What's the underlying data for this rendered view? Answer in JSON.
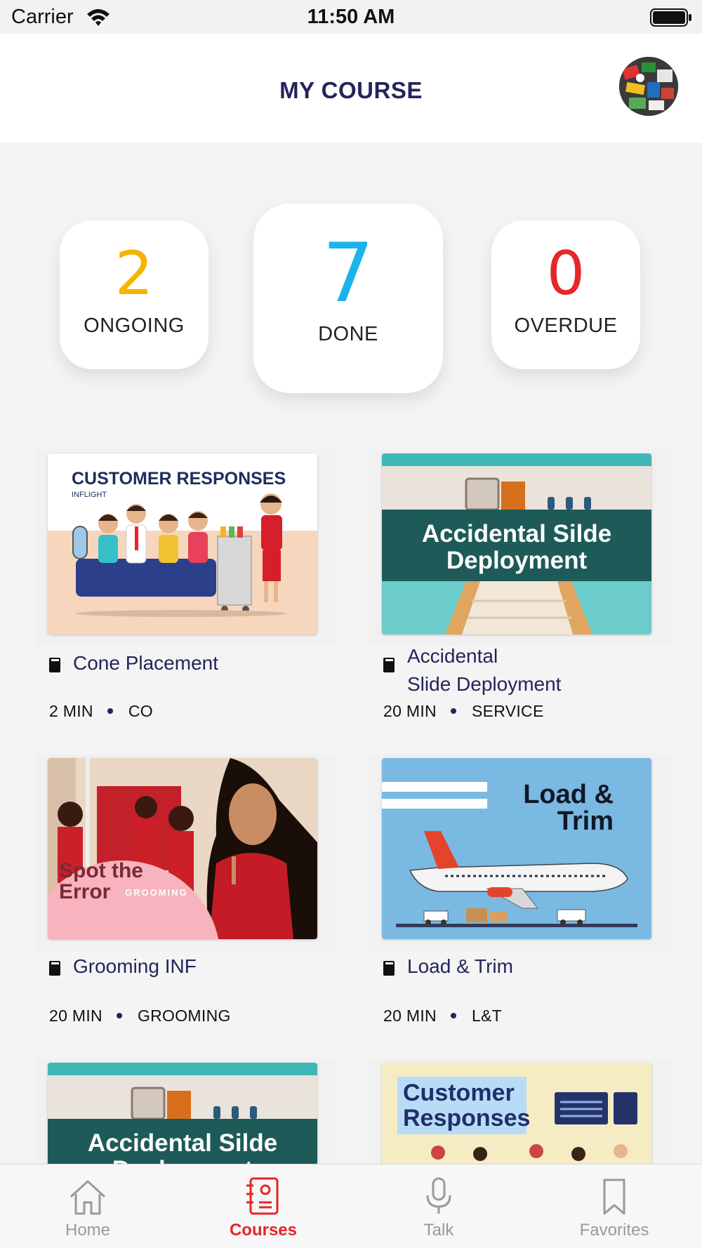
{
  "status_bar": {
    "carrier": "Carrier",
    "time": "11:50 AM"
  },
  "header": {
    "title": "MY COURSE"
  },
  "stats": {
    "ongoing": {
      "value": "2",
      "label": "ONGOING",
      "color": "#f6b400"
    },
    "done": {
      "value": "7",
      "label": "DONE",
      "color": "#1ab4ea"
    },
    "overdue": {
      "value": "0",
      "label": "OVERDUE",
      "color": "#e5262b"
    }
  },
  "courses": [
    {
      "title": "Cone Placement",
      "duration": "2 MIN",
      "category": "CO",
      "thumb": {
        "heading": "CUSTOMER RESPONSES",
        "subheading": "INFLIGHT"
      }
    },
    {
      "title_line1": "Accidental",
      "title_line2": "Slide Deployment",
      "duration": "20 MIN",
      "category": "SERVICE",
      "thumb": {
        "line1": "Accidental Silde",
        "line2": "Deployment"
      }
    },
    {
      "title": "Grooming INF",
      "duration": "20 MIN",
      "category": "GROOMING",
      "thumb": {
        "line1": "Spot the",
        "line2": "Error",
        "tag": "GROOMING"
      }
    },
    {
      "title": "Load & Trim",
      "duration": "20 MIN",
      "category": "L&T",
      "thumb": {
        "line1": "Load &",
        "line2": "Trim"
      }
    },
    {
      "thumb": {
        "line1": "Accidental Silde",
        "line2": "Deployment"
      }
    },
    {
      "thumb": {
        "line1": "Customer",
        "line2": "Responses"
      }
    }
  ],
  "tabs": [
    {
      "label": "Home",
      "icon": "home-icon"
    },
    {
      "label": "Courses",
      "icon": "courses-icon",
      "active": true
    },
    {
      "label": "Talk",
      "icon": "microphone-icon"
    },
    {
      "label": "Favorites",
      "icon": "bookmark-icon"
    }
  ],
  "colors": {
    "navy": "#23255a",
    "accent": "#e3262b",
    "inactive": "#9a9a9a"
  }
}
